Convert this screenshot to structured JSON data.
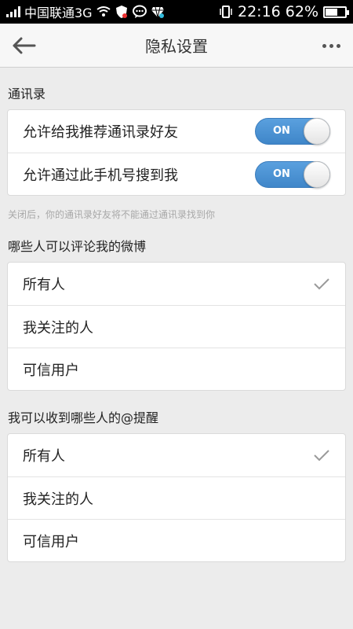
{
  "status_bar": {
    "carrier": "中国联通3G",
    "time": "22:16",
    "battery": "62%",
    "battery_level": 0.62,
    "icons": [
      "signal-icon",
      "wifi-icon",
      "shield-icon",
      "chat-icon",
      "diamond-icon",
      "vibrate-icon",
      "battery-icon"
    ]
  },
  "titlebar": {
    "title": "隐私设置",
    "back_icon": "arrow-left-icon",
    "more_icon": "more-horizontal-icon"
  },
  "contacts": {
    "header": "通讯录",
    "items": [
      {
        "label": "允许给我推荐通讯录好友",
        "toggle": "ON",
        "state": true
      },
      {
        "label": "允许通过此手机号搜到我",
        "toggle": "ON",
        "state": true
      }
    ],
    "hint": "关闭后，你的通讯录好友将不能通过通讯录找到你"
  },
  "comments": {
    "header": "哪些人可以评论我的微博",
    "options": [
      {
        "label": "所有人",
        "selected": true
      },
      {
        "label": "我关注的人",
        "selected": false
      },
      {
        "label": "可信用户",
        "selected": false
      }
    ]
  },
  "mentions": {
    "header": "我可以收到哪些人的@提醒",
    "options": [
      {
        "label": "所有人",
        "selected": true
      },
      {
        "label": "我关注的人",
        "selected": false
      },
      {
        "label": "可信用户",
        "selected": false
      }
    ]
  },
  "colors": {
    "toggle_on": "#4a91d4",
    "background": "#ececec",
    "check": "#9a9a9a"
  }
}
